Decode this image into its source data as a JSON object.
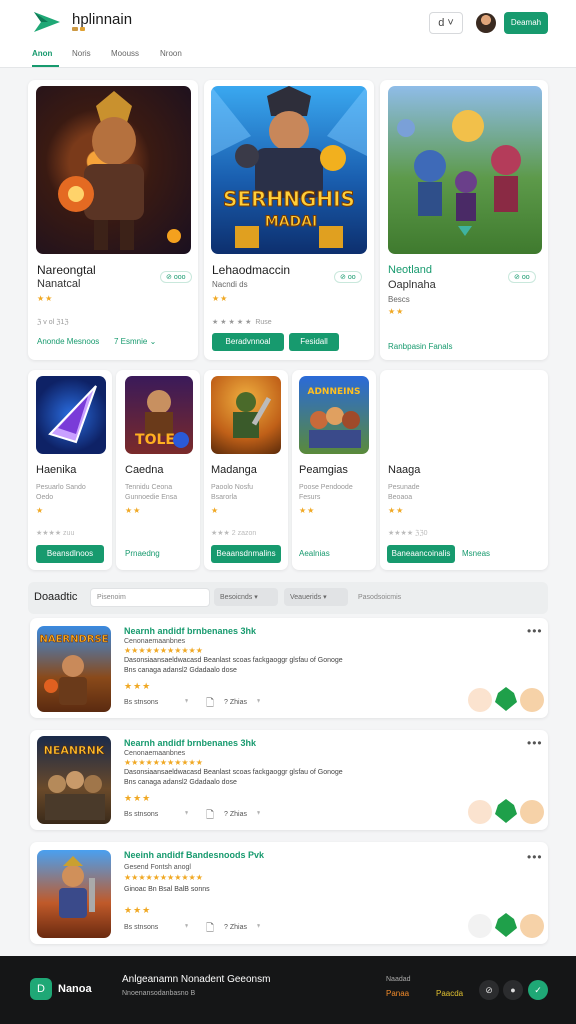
{
  "header": {
    "brand": "hplinnain",
    "brand_sub": "",
    "icon_button_label": "d ˅",
    "cta_label": "Deamah"
  },
  "tabs": [
    {
      "label": "Anon",
      "active": true
    },
    {
      "label": "Noris",
      "active": false
    },
    {
      "label": "Moouss",
      "active": false
    },
    {
      "label": "Nroon",
      "active": false
    }
  ],
  "featured": [
    {
      "title": "Nareongtal",
      "subtitle": "Nanatcal",
      "badge": "ooo",
      "meta": "ℨ v ol  ℨ1ℨ",
      "link_label": "Anonde Mesnoos",
      "link_label2": "7 Esmnie ⌄"
    },
    {
      "title": "Lehaodmaccin",
      "subtitle": "Nacnds",
      "meta_sub": "Nacndi ds",
      "badge": "oo",
      "meta": "Ruse",
      "button1": "Beradvnnoal",
      "button2": "Fesidall"
    },
    {
      "title": "Neotland",
      "subtitle": "Oaplnaha",
      "meta_sub": "Bescs",
      "badge": "oo",
      "link_label": "Ranbpasin Fanals"
    }
  ],
  "thumb_title_art": "SERHNGHIS MADAI",
  "thumbs": [
    {
      "title": "Haenika",
      "meta1": "Pesuarlo Sando",
      "meta2": "Oedo",
      "meta3": "zuu",
      "cta": "Beansdlnoos",
      "cta_style": "button"
    },
    {
      "title": "Caedna",
      "meta1": "Tennidu Ceona",
      "meta2": "Gunnoedie Ensa",
      "cta": "Prnaedng",
      "cta_style": "link"
    },
    {
      "title": "Madanga",
      "meta1": "Paoolo Nosfu",
      "meta2": "Bsarorla",
      "meta3": "2 zazon",
      "cta": "Beaansdnmalins",
      "cta_style": "button"
    },
    {
      "title": "Peamgias",
      "meta1": "Poose Pendoode",
      "meta2": "Fesurs",
      "cta": "Aealnias",
      "cta_style": "link"
    },
    {
      "title": "Naaga",
      "meta1": "Pesunade",
      "meta2": "Beoaoa",
      "meta3": "ℨℨ0",
      "cta": "Baneaancoinalis",
      "cta2": "Msneas",
      "cta_style": "button"
    }
  ],
  "filter": {
    "label": "Doaadtic",
    "search_placeholder": "Pisenoim",
    "select1": "Besoicnds ▾",
    "select2": "Veauerids ▾",
    "select3": "Pasodsoicmis"
  },
  "list": [
    {
      "title": "Nearnh andidf brnbenanes 3hk",
      "sub": "Cenonaemaanbnes",
      "desc1": "Dasonsiaansaeldwacasd Beanlast scoas fackgaoggr glsfau of Gonoge",
      "desc2": "Bns canaga adansl2 Gdadaalo dose",
      "meta": "Bs stnsons",
      "meta2": "Zhias",
      "art_title": "NAERNDRSE"
    },
    {
      "title": "Nearnh andidf brnbenanes 3hk",
      "sub": "Cenonaemaanbnes",
      "desc1": "Dasonsiaansaeldwacasd Beanlast scoas fackgaoggr glsfau of Gonoge",
      "desc2": "Bns canaga adansl2 Gdadaalo dose",
      "meta": "Bs stnsons",
      "meta2": "Zhias",
      "art_title": "NEANRNK"
    },
    {
      "title": "Neeinh andidf Bandesnoods Pvk",
      "sub": "Gesend Fontsh anogl",
      "desc1": "Ginoac Bn Bsal BalB sonns",
      "desc2": "",
      "meta": "Bs stnsons",
      "meta2": "Zhias",
      "art_title": ""
    }
  ],
  "footer": {
    "badge_letter": "D",
    "brand": "Nanoa",
    "heading": "Anlgeanamn Nonadent Geeonsm",
    "sub": "Nnoenansodanbasno B",
    "col1_title": "Naadad",
    "col1_link": "Panaa",
    "col2_link": "Paacda"
  },
  "colors": {
    "accent": "#179a6e",
    "star": "#f0a823",
    "footer_bg": "#151617"
  },
  "icons": [
    "logo-play-icon",
    "bookmark-icon",
    "more-dots-icon",
    "share-icon",
    "music-icon",
    "download-icon",
    "leaf-icon",
    "heart-icon"
  ]
}
